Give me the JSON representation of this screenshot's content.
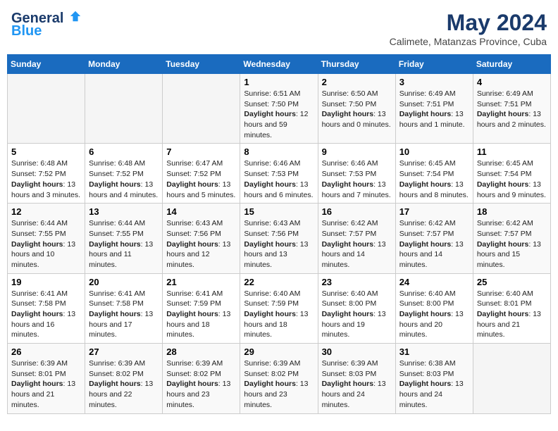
{
  "header": {
    "logo_line1": "General",
    "logo_line2": "Blue",
    "main_title": "May 2024",
    "subtitle": "Calimete, Matanzas Province, Cuba"
  },
  "days_of_week": [
    "Sunday",
    "Monday",
    "Tuesday",
    "Wednesday",
    "Thursday",
    "Friday",
    "Saturday"
  ],
  "weeks": [
    [
      {
        "day": "",
        "content": ""
      },
      {
        "day": "",
        "content": ""
      },
      {
        "day": "",
        "content": ""
      },
      {
        "day": "1",
        "content": "Sunrise: 6:51 AM\nSunset: 7:50 PM\nDaylight: 12 hours and 59 minutes."
      },
      {
        "day": "2",
        "content": "Sunrise: 6:50 AM\nSunset: 7:50 PM\nDaylight: 13 hours and 0 minutes."
      },
      {
        "day": "3",
        "content": "Sunrise: 6:49 AM\nSunset: 7:51 PM\nDaylight: 13 hours and 1 minute."
      },
      {
        "day": "4",
        "content": "Sunrise: 6:49 AM\nSunset: 7:51 PM\nDaylight: 13 hours and 2 minutes."
      }
    ],
    [
      {
        "day": "5",
        "content": "Sunrise: 6:48 AM\nSunset: 7:52 PM\nDaylight: 13 hours and 3 minutes."
      },
      {
        "day": "6",
        "content": "Sunrise: 6:48 AM\nSunset: 7:52 PM\nDaylight: 13 hours and 4 minutes."
      },
      {
        "day": "7",
        "content": "Sunrise: 6:47 AM\nSunset: 7:52 PM\nDaylight: 13 hours and 5 minutes."
      },
      {
        "day": "8",
        "content": "Sunrise: 6:46 AM\nSunset: 7:53 PM\nDaylight: 13 hours and 6 minutes."
      },
      {
        "day": "9",
        "content": "Sunrise: 6:46 AM\nSunset: 7:53 PM\nDaylight: 13 hours and 7 minutes."
      },
      {
        "day": "10",
        "content": "Sunrise: 6:45 AM\nSunset: 7:54 PM\nDaylight: 13 hours and 8 minutes."
      },
      {
        "day": "11",
        "content": "Sunrise: 6:45 AM\nSunset: 7:54 PM\nDaylight: 13 hours and 9 minutes."
      }
    ],
    [
      {
        "day": "12",
        "content": "Sunrise: 6:44 AM\nSunset: 7:55 PM\nDaylight: 13 hours and 10 minutes."
      },
      {
        "day": "13",
        "content": "Sunrise: 6:44 AM\nSunset: 7:55 PM\nDaylight: 13 hours and 11 minutes."
      },
      {
        "day": "14",
        "content": "Sunrise: 6:43 AM\nSunset: 7:56 PM\nDaylight: 13 hours and 12 minutes."
      },
      {
        "day": "15",
        "content": "Sunrise: 6:43 AM\nSunset: 7:56 PM\nDaylight: 13 hours and 13 minutes."
      },
      {
        "day": "16",
        "content": "Sunrise: 6:42 AM\nSunset: 7:57 PM\nDaylight: 13 hours and 14 minutes."
      },
      {
        "day": "17",
        "content": "Sunrise: 6:42 AM\nSunset: 7:57 PM\nDaylight: 13 hours and 14 minutes."
      },
      {
        "day": "18",
        "content": "Sunrise: 6:42 AM\nSunset: 7:57 PM\nDaylight: 13 hours and 15 minutes."
      }
    ],
    [
      {
        "day": "19",
        "content": "Sunrise: 6:41 AM\nSunset: 7:58 PM\nDaylight: 13 hours and 16 minutes."
      },
      {
        "day": "20",
        "content": "Sunrise: 6:41 AM\nSunset: 7:58 PM\nDaylight: 13 hours and 17 minutes."
      },
      {
        "day": "21",
        "content": "Sunrise: 6:41 AM\nSunset: 7:59 PM\nDaylight: 13 hours and 18 minutes."
      },
      {
        "day": "22",
        "content": "Sunrise: 6:40 AM\nSunset: 7:59 PM\nDaylight: 13 hours and 18 minutes."
      },
      {
        "day": "23",
        "content": "Sunrise: 6:40 AM\nSunset: 8:00 PM\nDaylight: 13 hours and 19 minutes."
      },
      {
        "day": "24",
        "content": "Sunrise: 6:40 AM\nSunset: 8:00 PM\nDaylight: 13 hours and 20 minutes."
      },
      {
        "day": "25",
        "content": "Sunrise: 6:40 AM\nSunset: 8:01 PM\nDaylight: 13 hours and 21 minutes."
      }
    ],
    [
      {
        "day": "26",
        "content": "Sunrise: 6:39 AM\nSunset: 8:01 PM\nDaylight: 13 hours and 21 minutes."
      },
      {
        "day": "27",
        "content": "Sunrise: 6:39 AM\nSunset: 8:02 PM\nDaylight: 13 hours and 22 minutes."
      },
      {
        "day": "28",
        "content": "Sunrise: 6:39 AM\nSunset: 8:02 PM\nDaylight: 13 hours and 23 minutes."
      },
      {
        "day": "29",
        "content": "Sunrise: 6:39 AM\nSunset: 8:02 PM\nDaylight: 13 hours and 23 minutes."
      },
      {
        "day": "30",
        "content": "Sunrise: 6:39 AM\nSunset: 8:03 PM\nDaylight: 13 hours and 24 minutes."
      },
      {
        "day": "31",
        "content": "Sunrise: 6:38 AM\nSunset: 8:03 PM\nDaylight: 13 hours and 24 minutes."
      },
      {
        "day": "",
        "content": ""
      }
    ]
  ]
}
